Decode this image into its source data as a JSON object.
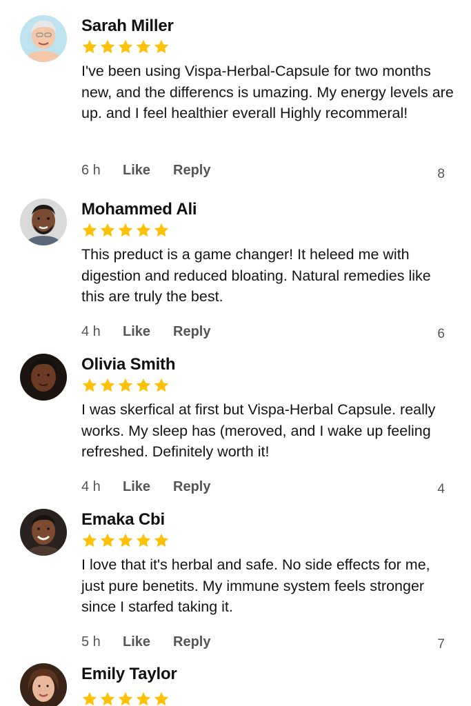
{
  "reviews": [
    {
      "name": "Sarah Miller",
      "rating": 5,
      "text": "I've been using Vispa-Herbal-Capsule for two months new, and the differencs is umazing. My energy levels are up. and I feel healthier everall Highly recommeral!",
      "time": "6 h",
      "like_label": "Like",
      "reply_label": "Reply",
      "count": "8"
    },
    {
      "name": "Mohammed Ali",
      "rating": 5,
      "text": "This preduct is a game changer! It heleed me with digestion and reduced bloating. Natural remedies like this are truly the best.",
      "time": "4 h",
      "like_label": "Like",
      "reply_label": "Reply",
      "count": "6"
    },
    {
      "name": "Olivia Smith",
      "rating": 5,
      "text": "I was skerfical at first but Vispa-Herbal Capsule. really works. My sleep has (meroved, and I wake up feeling refreshed. Definitely worth it!",
      "time": "4 h",
      "like_label": "Like",
      "reply_label": "Reply",
      "count": "4"
    },
    {
      "name": "Emaka Cbi",
      "rating": 5,
      "text": "I love that it's herbal and safe. No side effects for me, just pure benetits. My immune system feels stronger since I starfed taking it.",
      "time": "5 h",
      "like_label": "Like",
      "reply_label": "Reply",
      "count": "7"
    },
    {
      "name": "Emily Taylor",
      "rating": 5,
      "text": "",
      "time": "",
      "like_label": "",
      "reply_label": "",
      "count": ""
    }
  ],
  "colors": {
    "star": "#FFC107",
    "text": "#141414",
    "meta": "#555555"
  },
  "icons": {
    "star": "star-icon",
    "avatar": "avatar"
  }
}
